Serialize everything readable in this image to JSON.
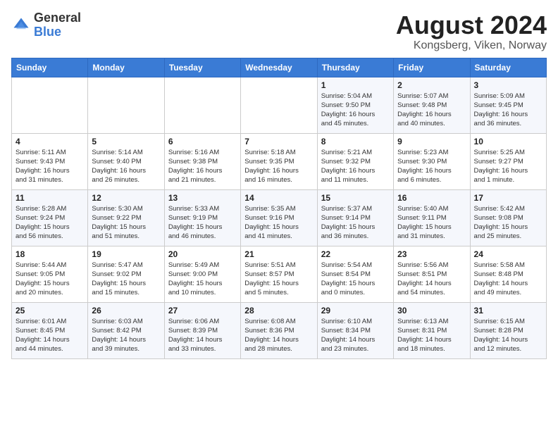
{
  "logo": {
    "general": "General",
    "blue": "Blue"
  },
  "title": "August 2024",
  "subtitle": "Kongsberg, Viken, Norway",
  "headers": [
    "Sunday",
    "Monday",
    "Tuesday",
    "Wednesday",
    "Thursday",
    "Friday",
    "Saturday"
  ],
  "rows": [
    [
      {
        "day": "",
        "detail": ""
      },
      {
        "day": "",
        "detail": ""
      },
      {
        "day": "",
        "detail": ""
      },
      {
        "day": "",
        "detail": ""
      },
      {
        "day": "1",
        "detail": "Sunrise: 5:04 AM\nSunset: 9:50 PM\nDaylight: 16 hours\nand 45 minutes."
      },
      {
        "day": "2",
        "detail": "Sunrise: 5:07 AM\nSunset: 9:48 PM\nDaylight: 16 hours\nand 40 minutes."
      },
      {
        "day": "3",
        "detail": "Sunrise: 5:09 AM\nSunset: 9:45 PM\nDaylight: 16 hours\nand 36 minutes."
      }
    ],
    [
      {
        "day": "4",
        "detail": "Sunrise: 5:11 AM\nSunset: 9:43 PM\nDaylight: 16 hours\nand 31 minutes."
      },
      {
        "day": "5",
        "detail": "Sunrise: 5:14 AM\nSunset: 9:40 PM\nDaylight: 16 hours\nand 26 minutes."
      },
      {
        "day": "6",
        "detail": "Sunrise: 5:16 AM\nSunset: 9:38 PM\nDaylight: 16 hours\nand 21 minutes."
      },
      {
        "day": "7",
        "detail": "Sunrise: 5:18 AM\nSunset: 9:35 PM\nDaylight: 16 hours\nand 16 minutes."
      },
      {
        "day": "8",
        "detail": "Sunrise: 5:21 AM\nSunset: 9:32 PM\nDaylight: 16 hours\nand 11 minutes."
      },
      {
        "day": "9",
        "detail": "Sunrise: 5:23 AM\nSunset: 9:30 PM\nDaylight: 16 hours\nand 6 minutes."
      },
      {
        "day": "10",
        "detail": "Sunrise: 5:25 AM\nSunset: 9:27 PM\nDaylight: 16 hours\nand 1 minute."
      }
    ],
    [
      {
        "day": "11",
        "detail": "Sunrise: 5:28 AM\nSunset: 9:24 PM\nDaylight: 15 hours\nand 56 minutes."
      },
      {
        "day": "12",
        "detail": "Sunrise: 5:30 AM\nSunset: 9:22 PM\nDaylight: 15 hours\nand 51 minutes."
      },
      {
        "day": "13",
        "detail": "Sunrise: 5:33 AM\nSunset: 9:19 PM\nDaylight: 15 hours\nand 46 minutes."
      },
      {
        "day": "14",
        "detail": "Sunrise: 5:35 AM\nSunset: 9:16 PM\nDaylight: 15 hours\nand 41 minutes."
      },
      {
        "day": "15",
        "detail": "Sunrise: 5:37 AM\nSunset: 9:14 PM\nDaylight: 15 hours\nand 36 minutes."
      },
      {
        "day": "16",
        "detail": "Sunrise: 5:40 AM\nSunset: 9:11 PM\nDaylight: 15 hours\nand 31 minutes."
      },
      {
        "day": "17",
        "detail": "Sunrise: 5:42 AM\nSunset: 9:08 PM\nDaylight: 15 hours\nand 25 minutes."
      }
    ],
    [
      {
        "day": "18",
        "detail": "Sunrise: 5:44 AM\nSunset: 9:05 PM\nDaylight: 15 hours\nand 20 minutes."
      },
      {
        "day": "19",
        "detail": "Sunrise: 5:47 AM\nSunset: 9:02 PM\nDaylight: 15 hours\nand 15 minutes."
      },
      {
        "day": "20",
        "detail": "Sunrise: 5:49 AM\nSunset: 9:00 PM\nDaylight: 15 hours\nand 10 minutes."
      },
      {
        "day": "21",
        "detail": "Sunrise: 5:51 AM\nSunset: 8:57 PM\nDaylight: 15 hours\nand 5 minutes."
      },
      {
        "day": "22",
        "detail": "Sunrise: 5:54 AM\nSunset: 8:54 PM\nDaylight: 15 hours\nand 0 minutes."
      },
      {
        "day": "23",
        "detail": "Sunrise: 5:56 AM\nSunset: 8:51 PM\nDaylight: 14 hours\nand 54 minutes."
      },
      {
        "day": "24",
        "detail": "Sunrise: 5:58 AM\nSunset: 8:48 PM\nDaylight: 14 hours\nand 49 minutes."
      }
    ],
    [
      {
        "day": "25",
        "detail": "Sunrise: 6:01 AM\nSunset: 8:45 PM\nDaylight: 14 hours\nand 44 minutes."
      },
      {
        "day": "26",
        "detail": "Sunrise: 6:03 AM\nSunset: 8:42 PM\nDaylight: 14 hours\nand 39 minutes."
      },
      {
        "day": "27",
        "detail": "Sunrise: 6:06 AM\nSunset: 8:39 PM\nDaylight: 14 hours\nand 33 minutes."
      },
      {
        "day": "28",
        "detail": "Sunrise: 6:08 AM\nSunset: 8:36 PM\nDaylight: 14 hours\nand 28 minutes."
      },
      {
        "day": "29",
        "detail": "Sunrise: 6:10 AM\nSunset: 8:34 PM\nDaylight: 14 hours\nand 23 minutes."
      },
      {
        "day": "30",
        "detail": "Sunrise: 6:13 AM\nSunset: 8:31 PM\nDaylight: 14 hours\nand 18 minutes."
      },
      {
        "day": "31",
        "detail": "Sunrise: 6:15 AM\nSunset: 8:28 PM\nDaylight: 14 hours\nand 12 minutes."
      }
    ]
  ]
}
